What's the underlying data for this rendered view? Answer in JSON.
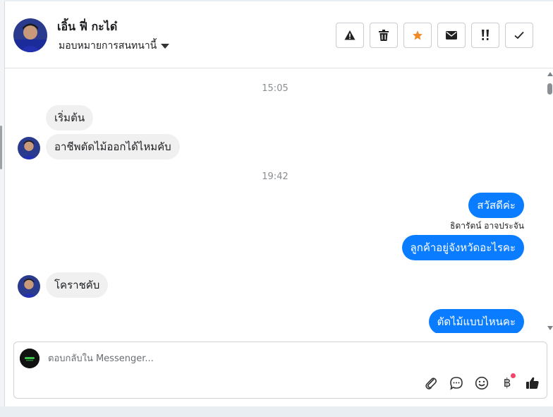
{
  "header": {
    "contact_name": "เอิ้น ฟี่ กะได๋",
    "assign_label": "มอบหมายการสนทนานี้",
    "actions": [
      {
        "id": "spam",
        "icon": "warning-icon"
      },
      {
        "id": "delete",
        "icon": "trash-icon"
      },
      {
        "id": "star",
        "icon": "star-icon",
        "color": "#f08a24"
      },
      {
        "id": "unread",
        "icon": "envelope-icon"
      },
      {
        "id": "followup",
        "icon": "double-exclamation-icon"
      },
      {
        "id": "done",
        "icon": "check-icon"
      }
    ]
  },
  "messages": {
    "time_1": "15:05",
    "in_1": "เริ่มต้น",
    "in_2": "อาชีพตัดไม้ออกได้ไหมคับ",
    "time_2": "19:42",
    "out_1": "สวัสดีค่ะ",
    "out_1_sender": "ธิดารัตน์ อาจประจัน",
    "out_2": "ลูกค้าอยู่จังหวัดอะไรคะ",
    "in_3": "โคราชคับ",
    "out_3": "ตัดไม้แบบไหนคะ"
  },
  "composer": {
    "placeholder": "ตอบกลับใน Messenger...",
    "value": "",
    "tools": [
      "paperclip-icon",
      "chat-bubble-icon",
      "emoji-icon",
      "baht-icon",
      "thumbs-up-icon"
    ],
    "baht_symbol": "฿",
    "notification_dot_color": "#f0466a"
  },
  "colors": {
    "outgoing_bubble": "#0a7cff",
    "incoming_bubble": "#f0f0f0",
    "timestamp": "#8a8d91"
  }
}
